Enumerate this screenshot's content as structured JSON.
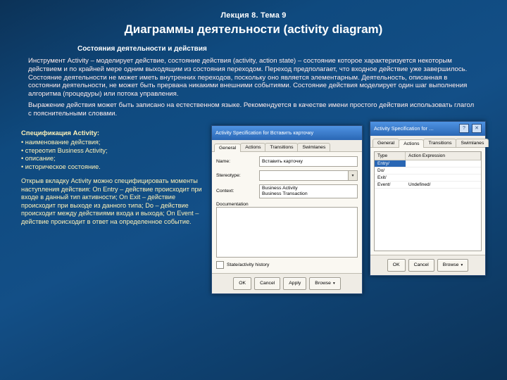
{
  "pretitle": "Лекция 8. Тема 9",
  "title": "Диаграммы деятельности (activity diagram)",
  "subhead": "Состояния деятельности и действия",
  "para1": "Инструмент Activity – моделирует действие, состояние действия (activity, action state) – состояние которое характеризуется некоторым действием и по крайней мере одним выходящим из состояния переходом. Переход предполагает, что входное действие уже завершилось. Состояние деятельности не может иметь внутренних переходов, поскольку оно является элементарным. Деятельность, описанная в состоянии деятельности, не может быть прервана никакими внешними событиями. Состояние действия моделирует один шаг выполнения алгоритма (процедуры) или потока управления.",
  "para2": "Выражение действия может быть записано на естественном языке. Рекомендуется в качестве имени простого действия использовать глагол с пояснительными словами.",
  "spec_title": "Спецификация Activity:",
  "spec_items": {
    "0": "наименование действия;",
    "1": "стереотип Business Activity;",
    "2": "описание;",
    "3": "историческое состояние."
  },
  "para3": "Открыв вкладку Activity можно специфицировать моменты наступления действия: On Entry – действие происходит при входе в данный тип активности; On Exit – действие происходит при выходе из данного типа; Do – действие происходит между действиями входа и выхода; On Event – действие происходит в ответ на определенное событие.",
  "win1": {
    "title": "Activity Specification for Вставить карточку",
    "tabs": {
      "0": "General",
      "1": "Actions",
      "2": "Transitions",
      "3": "Swimlanes"
    },
    "labels": {
      "name": "Name:",
      "stereo": "Stereotype:",
      "context": "Context:",
      "doc": "Documentation"
    },
    "name_value": "Вставить карточку",
    "stereo_value": "",
    "context_items": {
      "0": "Business Activity",
      "1": "Business Transaction"
    },
    "check": "State/activity history",
    "buttons": {
      "ok": "OK",
      "cancel": "Cancel",
      "apply": "Apply",
      "browse": "Browse"
    }
  },
  "win2": {
    "title": "Activity Specification for …",
    "help": "?",
    "close": "✕",
    "tabs": {
      "0": "General",
      "1": "Actions",
      "2": "Transitions",
      "3": "Swimlanes"
    },
    "grid": {
      "head": {
        "0": "Type",
        "1": "Action Expression"
      },
      "rows": {
        "0": {
          "c0": "Entry/",
          "c1": ""
        },
        "1": {
          "c0": "Do/",
          "c1": ""
        },
        "2": {
          "c0": "Exit/",
          "c1": ""
        },
        "3": {
          "c0": "Event/",
          "c1": "Undefined/"
        }
      }
    },
    "buttons": {
      "ok": "OK",
      "cancel": "Cancel",
      "browse": "Browse"
    }
  }
}
